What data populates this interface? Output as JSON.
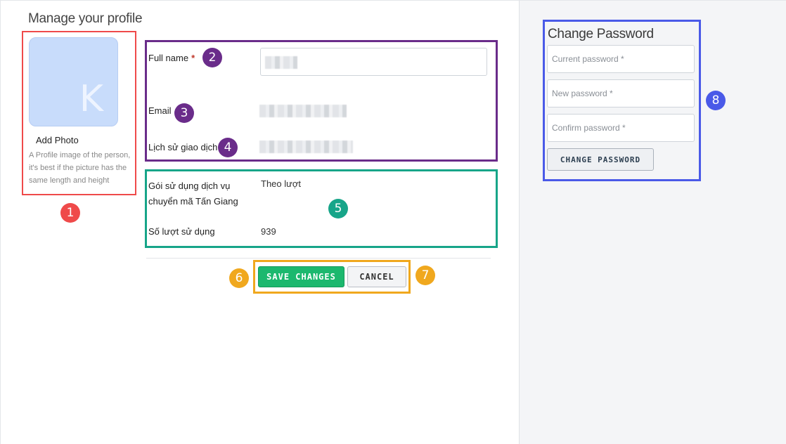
{
  "profile": {
    "page_title": "Manage your profile",
    "avatar_letter": "K",
    "add_photo_label": "Add Photo",
    "photo_hint": "A Profile image of the person, it's best if the picture has the same length and height"
  },
  "form": {
    "full_name_label": "Full name",
    "required_mark": "*",
    "email_label": "Email",
    "history_label": "Lịch sử giao dịch"
  },
  "service": {
    "plan_label_line1": "Gói sử dụng dịch vụ",
    "plan_label_line2": "chuyển mã Tấn Giang",
    "plan_value": "Theo lượt",
    "usage_label": "Số lượt sử dụng",
    "usage_value": "939"
  },
  "actions": {
    "save_label": "SAVE CHANGES",
    "cancel_label": "CANCEL"
  },
  "password": {
    "title": "Change Password",
    "current_placeholder": "Current password *",
    "new_placeholder": "New password *",
    "confirm_placeholder": "Confirm password *",
    "button_label": "CHANGE PASSWORD"
  },
  "annotations": [
    "1",
    "2",
    "3",
    "4",
    "5",
    "6",
    "7",
    "8"
  ],
  "colors": {
    "save_green": "#1cb86e",
    "marker_red": "#ef4a4a",
    "marker_purple": "#6a2c8a",
    "marker_teal": "#17a589",
    "marker_orange": "#f0a81e",
    "marker_blue": "#4a5ae8"
  }
}
